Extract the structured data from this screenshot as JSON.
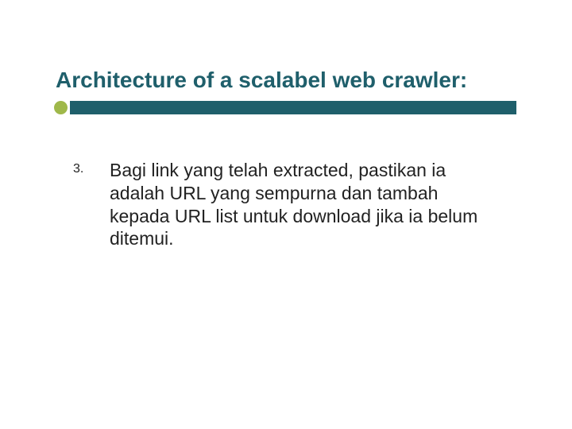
{
  "slide": {
    "title": "Architecture of a scalabel web crawler:",
    "list": {
      "number": "3.",
      "text": "Bagi link yang telah extracted, pastikan ia adalah URL yang sempurna dan tambah kepada URL list untuk download jika ia belum ditemui."
    },
    "colors": {
      "accent": "#1f5f6b",
      "dot": "#9fb84a"
    }
  }
}
